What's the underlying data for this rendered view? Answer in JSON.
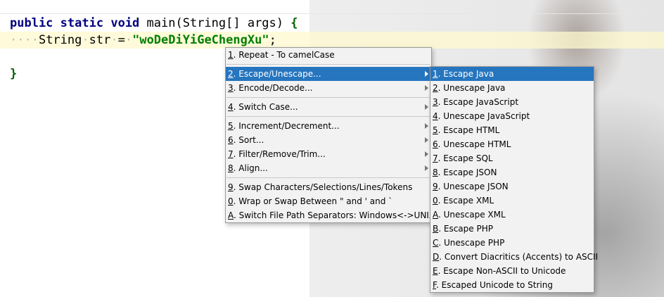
{
  "editor": {
    "line1": {
      "kw_public": "public",
      "kw_static": "static",
      "kw_void": "void",
      "rest": "main(String[] args)",
      "brace": "{"
    },
    "line2": {
      "type": "String",
      "var": "str",
      "eq": "=",
      "literal": "\"woDeDiYiGeChengXu\"",
      "semi": ";"
    },
    "line3": {
      "brace": "}"
    }
  },
  "main_menu": {
    "groups": [
      [
        {
          "mnemonic": "1",
          "label": ". Repeat - To camelCase",
          "submenu": false
        }
      ],
      [
        {
          "mnemonic": "2",
          "label": ". Escape/Unescape...",
          "submenu": true,
          "selected": true
        },
        {
          "mnemonic": "3",
          "label": ". Encode/Decode...",
          "submenu": true
        }
      ],
      [
        {
          "mnemonic": "4",
          "label": ". Switch Case...",
          "submenu": true
        }
      ],
      [
        {
          "mnemonic": "5",
          "label": ". Increment/Decrement...",
          "submenu": true
        },
        {
          "mnemonic": "6",
          "label": ". Sort...",
          "submenu": true
        },
        {
          "mnemonic": "7",
          "label": ". Filter/Remove/Trim...",
          "submenu": true
        },
        {
          "mnemonic": "8",
          "label": ". Align...",
          "submenu": true
        }
      ],
      [
        {
          "mnemonic": "9",
          "label": ". Swap Characters/Selections/Lines/Tokens",
          "submenu": false
        },
        {
          "mnemonic": "0",
          "label": ". Wrap or Swap Between \" and ' and `",
          "submenu": false
        },
        {
          "mnemonic": "A",
          "label": ". Switch File Path Separators: Windows<->UNIX",
          "submenu": false
        }
      ]
    ]
  },
  "sub_menu": {
    "items": [
      {
        "mnemonic": "1",
        "label": ". Escape Java",
        "selected": true
      },
      {
        "mnemonic": "2",
        "label": ". Unescape Java"
      },
      {
        "mnemonic": "3",
        "label": ". Escape JavaScript"
      },
      {
        "mnemonic": "4",
        "label": ". Unescape JavaScript"
      },
      {
        "mnemonic": "5",
        "label": ". Escape HTML"
      },
      {
        "mnemonic": "6",
        "label": ". Unescape HTML"
      },
      {
        "mnemonic": "7",
        "label": ". Escape SQL"
      },
      {
        "mnemonic": "8",
        "label": ". Escape JSON"
      },
      {
        "mnemonic": "9",
        "label": ". Unescape JSON"
      },
      {
        "mnemonic": "0",
        "label": ". Escape XML"
      },
      {
        "mnemonic": "A",
        "label": ". Unescape XML"
      },
      {
        "mnemonic": "B",
        "label": ". Escape PHP"
      },
      {
        "mnemonic": "C",
        "label": ". Unescape PHP"
      },
      {
        "mnemonic": "D",
        "label": ". Convert Diacritics (Accents) to ASCII"
      },
      {
        "mnemonic": "E",
        "label": ". Escape Non-ASCII to Unicode"
      },
      {
        "mnemonic": "F",
        "label": ". Escaped Unicode to String"
      }
    ]
  },
  "colors": {
    "selection": "#2675bf",
    "keyword": "#000080",
    "string_literal": "#008000"
  }
}
